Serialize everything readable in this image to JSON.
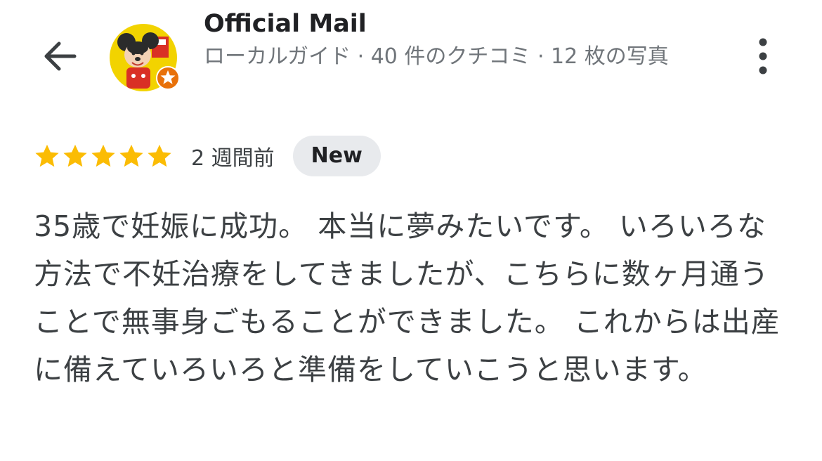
{
  "header": {
    "author_name": "Official Mail",
    "author_meta": "ローカルガイド · 40 件のクチコミ · 12 枚の写真",
    "back_icon": "arrow-back-icon",
    "more_icon": "more-vert-icon",
    "badge_icon": "local-guide-star-icon"
  },
  "review": {
    "rating": 5,
    "max_rating": 5,
    "timestamp": "2 週間前",
    "badge": "New",
    "text": "35歳で妊娠に成功。 本当に夢みたいです。 いろいろな方法で不妊治療をしてきましたが、こちらに数ヶ月通うことで無事身ごもることができました。 これからは出産に備えていろいろと準備をしていこうと思います。"
  },
  "colors": {
    "star": "#fbbc04",
    "badge_orange": "#e8710a",
    "new_badge_bg": "#e8eaed",
    "meta_text": "#70757a"
  }
}
